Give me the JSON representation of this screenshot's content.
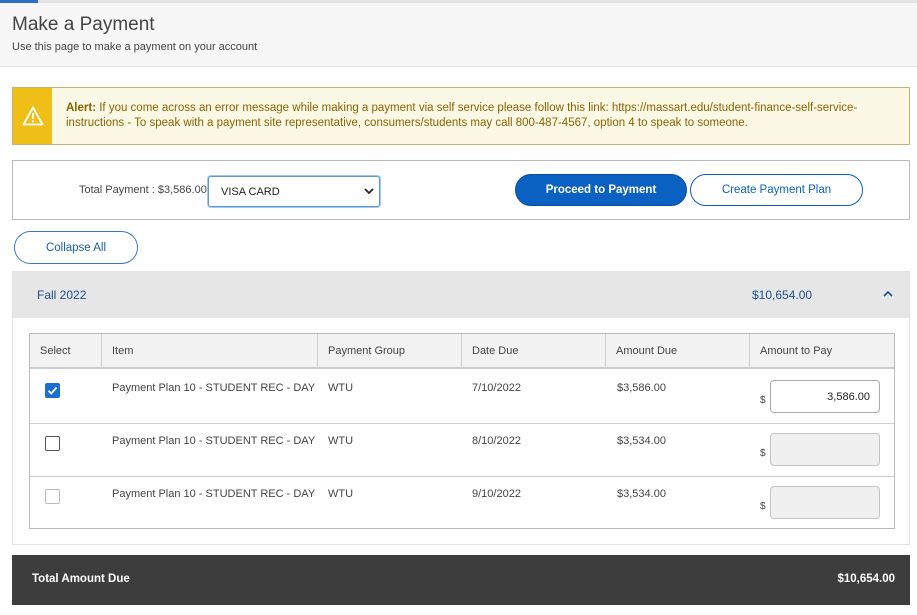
{
  "header": {
    "title": "Make a Payment",
    "subtitle": "Use this page to make a payment on your account"
  },
  "alert": {
    "label": "Alert:",
    "message": "If you come across an error message while making a payment via self service please follow this link: https://massart.edu/student-finance-self-service-instructions - To speak with a payment site representative, consumers/students may call 800-487-4567, option 4 to speak to someone.",
    "icon": "warning-icon",
    "color": "#efbe17"
  },
  "payment": {
    "total_label": "Total Payment : $3,586.00",
    "method_selected": "VISA CARD",
    "proceed_label": "Proceed to Payment",
    "plan_label": "Create Payment Plan",
    "accent": "#0b61c2"
  },
  "collapse_label": "Collapse All",
  "term": {
    "name": "Fall 2022",
    "total": "$10,654.00",
    "table": {
      "headers": [
        "Select",
        "Item",
        "Payment Group",
        "Date Due",
        "Amount Due",
        "Amount to Pay"
      ],
      "currency_symbol": "$",
      "rows": [
        {
          "selected": true,
          "item": "Payment Plan 10 - STUDENT REC - DAY",
          "group": "WTU",
          "date_due": "7/10/2022",
          "amount_due": "$3,586.00",
          "amount_to_pay": "3,586.00"
        },
        {
          "selected": false,
          "item": "Payment Plan 10 - STUDENT REC - DAY",
          "group": "WTU",
          "date_due": "8/10/2022",
          "amount_due": "$3,534.00",
          "amount_to_pay": ""
        },
        {
          "selected": false,
          "item": "Payment Plan 10 - STUDENT REC - DAY",
          "group": "WTU",
          "date_due": "9/10/2022",
          "amount_due": "$3,534.00",
          "amount_to_pay": ""
        }
      ]
    }
  },
  "footer": {
    "label": "Total Amount Due",
    "total": "$10,654.00"
  }
}
